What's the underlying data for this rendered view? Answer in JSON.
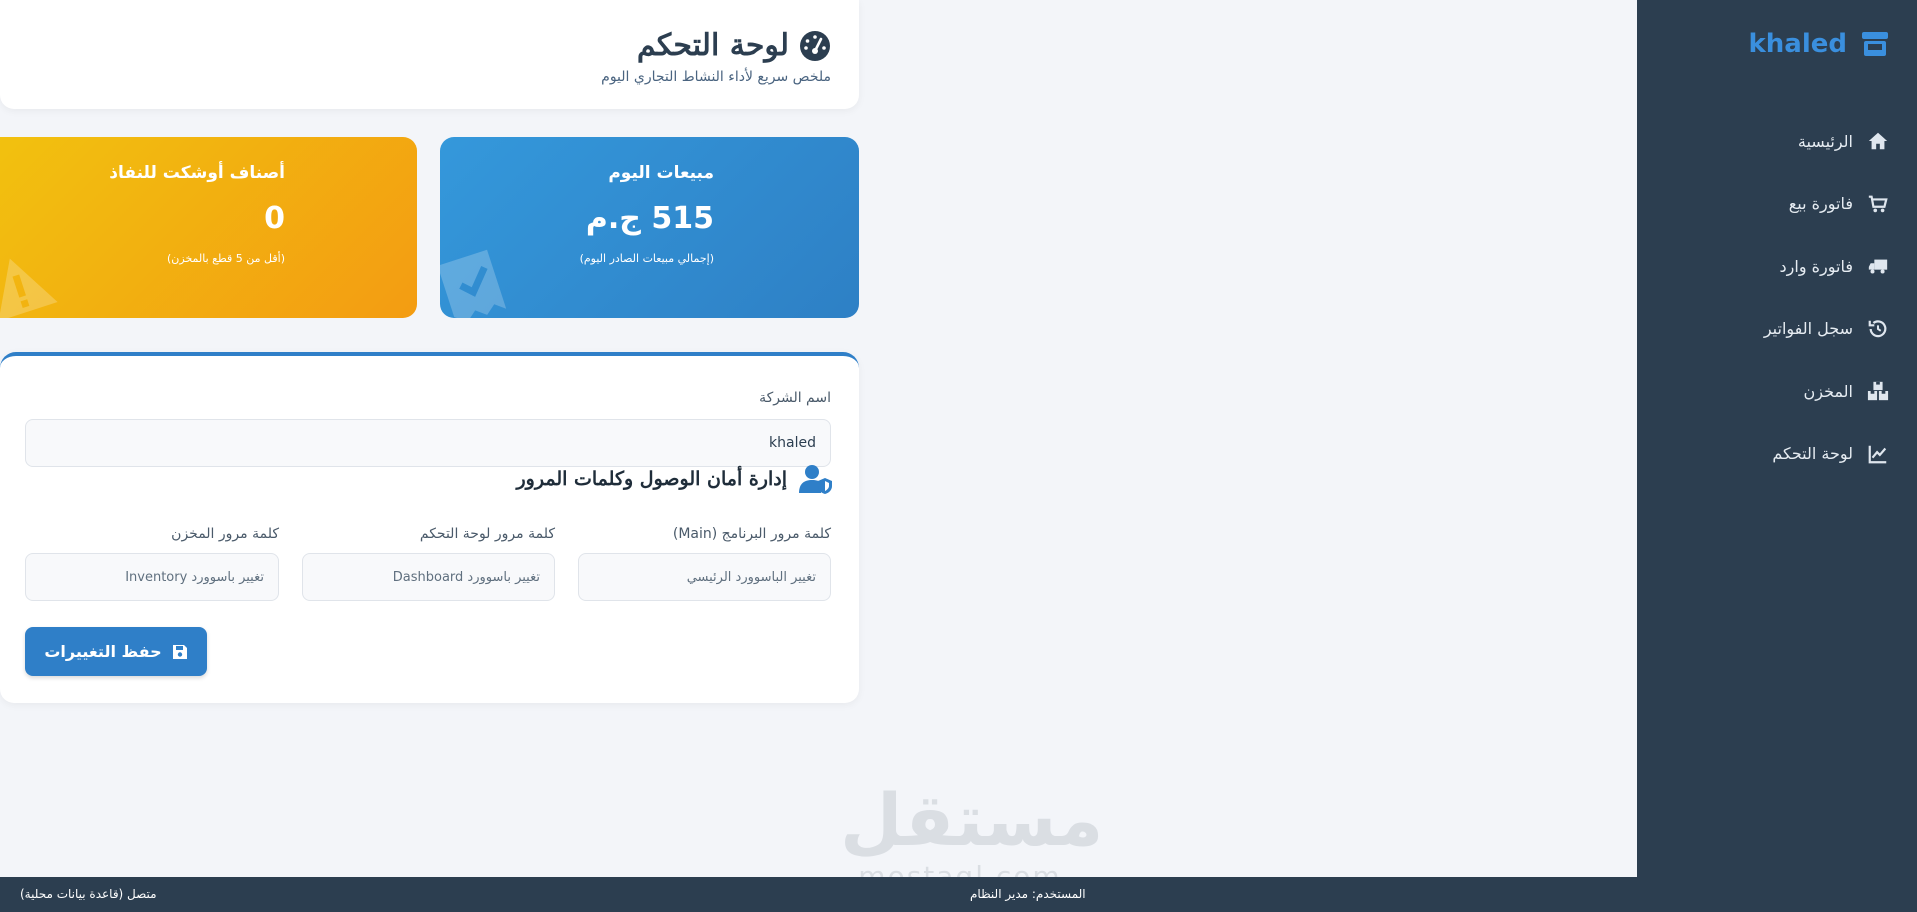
{
  "brand": {
    "name": "khaled",
    "icon": "store-icon"
  },
  "sidebar": {
    "items": [
      {
        "label": "الرئيسية",
        "icon": "home-icon"
      },
      {
        "label": "فاتورة بيع",
        "icon": "cart-icon"
      },
      {
        "label": "فاتورة وارد",
        "icon": "truck-icon"
      },
      {
        "label": "سجل الفواتير",
        "icon": "history-icon"
      },
      {
        "label": "المخزن",
        "icon": "boxes-icon"
      },
      {
        "label": "لوحة التحكم",
        "icon": "chart-line-icon"
      }
    ]
  },
  "header": {
    "title": "لوحة التحكم",
    "subtitle": "ملخص سريع لأداء النشاط التجاري اليوم",
    "icon": "gauge-icon"
  },
  "stats": {
    "sales": {
      "title": "مبيعات اليوم",
      "value": "515 ج.م",
      "note": "(إجمالي مبيعات الصادر اليوم)",
      "icon": "receipt-icon"
    },
    "low_stock": {
      "title": "أصناف أوشكت للنفاذ",
      "value": "0",
      "note": "(أقل من 5 قطع بالمخزن)",
      "icon": "warning-icon"
    }
  },
  "form": {
    "company_label": "اسم الشركة",
    "company_value": "khaled",
    "security_title": "إدارة أمان الوصول وكلمات المرور",
    "security_icon": "user-shield-icon",
    "passwords": [
      {
        "label": "كلمة مرور البرنامج (Main)",
        "placeholder": "تغيير الباسوورد الرئيسي"
      },
      {
        "label": "كلمة مرور لوحة التحكم",
        "placeholder": "تغيير باسوورد Dashboard"
      },
      {
        "label": "كلمة مرور المخزن",
        "placeholder": "تغيير باسوورد Inventory"
      }
    ],
    "save_label": "حفظ التغييرات",
    "save_icon": "floppy-disk-icon"
  },
  "footer": {
    "status": "متصل (قاعدة بيانات محلية)",
    "user": "المستخدم: مدير النظام"
  },
  "watermark": {
    "ar": "مستقل",
    "en": "mostaql.com"
  },
  "colors": {
    "sidebar": "#2c3e50",
    "accent": "#3498db",
    "warning": "#f39c12",
    "background": "#f3f5f9"
  }
}
